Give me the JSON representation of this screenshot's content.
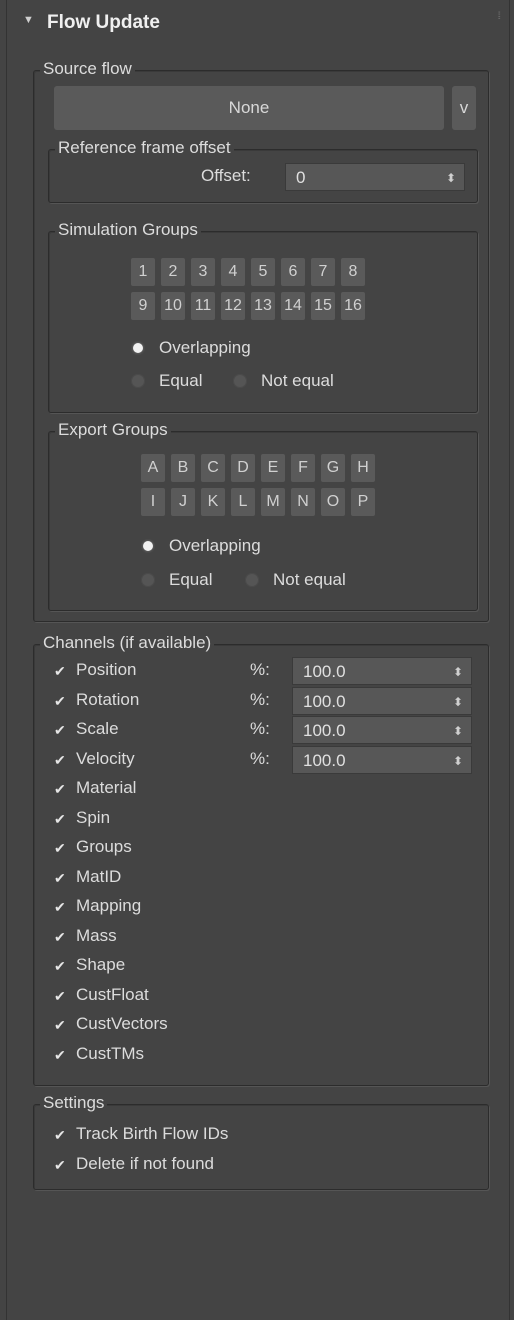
{
  "rollout": {
    "title": "Flow Update",
    "expanded": true
  },
  "source_flow": {
    "label": "Source flow",
    "button": "None",
    "dropdown": "v"
  },
  "reference_frame": {
    "label": "Reference frame offset",
    "offset_label": "Offset:",
    "offset_value": "0"
  },
  "simulation_groups": {
    "label": "Simulation Groups",
    "buttons": [
      "1",
      "2",
      "3",
      "4",
      "5",
      "6",
      "7",
      "8",
      "9",
      "10",
      "11",
      "12",
      "13",
      "14",
      "15",
      "16"
    ],
    "radio": {
      "overlapping": "Overlapping",
      "equal": "Equal",
      "not_equal": "Not equal",
      "selected": "overlapping"
    }
  },
  "export_groups": {
    "label": "Export Groups",
    "buttons": [
      "A",
      "B",
      "C",
      "D",
      "E",
      "F",
      "G",
      "H",
      "I",
      "J",
      "K",
      "L",
      "M",
      "N",
      "O",
      "P"
    ],
    "radio": {
      "overlapping": "Overlapping",
      "equal": "Equal",
      "not_equal": "Not equal",
      "selected": "overlapping"
    }
  },
  "channels": {
    "label": "Channels (if available)",
    "percent_label": "%:",
    "items": [
      {
        "label": "Position",
        "checked": true,
        "percent": "100.0"
      },
      {
        "label": "Rotation",
        "checked": true,
        "percent": "100.0"
      },
      {
        "label": "Scale",
        "checked": true,
        "percent": "100.0"
      },
      {
        "label": "Velocity",
        "checked": true,
        "percent": "100.0"
      },
      {
        "label": "Material",
        "checked": true
      },
      {
        "label": "Spin",
        "checked": true
      },
      {
        "label": "Groups",
        "checked": true
      },
      {
        "label": "MatID",
        "checked": true
      },
      {
        "label": "Mapping",
        "checked": true
      },
      {
        "label": "Mass",
        "checked": true
      },
      {
        "label": "Shape",
        "checked": true
      },
      {
        "label": "CustFloat",
        "checked": true
      },
      {
        "label": "CustVectors",
        "checked": true
      },
      {
        "label": "CustTMs",
        "checked": true
      }
    ]
  },
  "settings": {
    "label": "Settings",
    "items": [
      {
        "label": "Track Birth Flow IDs",
        "checked": true
      },
      {
        "label": "Delete if not found",
        "checked": true
      }
    ]
  },
  "icons": {
    "collapse": "triangle-down-icon",
    "grip": "grip-dots-icon",
    "check": "checkmark-icon",
    "spinner": "spinner-arrows-icon"
  }
}
